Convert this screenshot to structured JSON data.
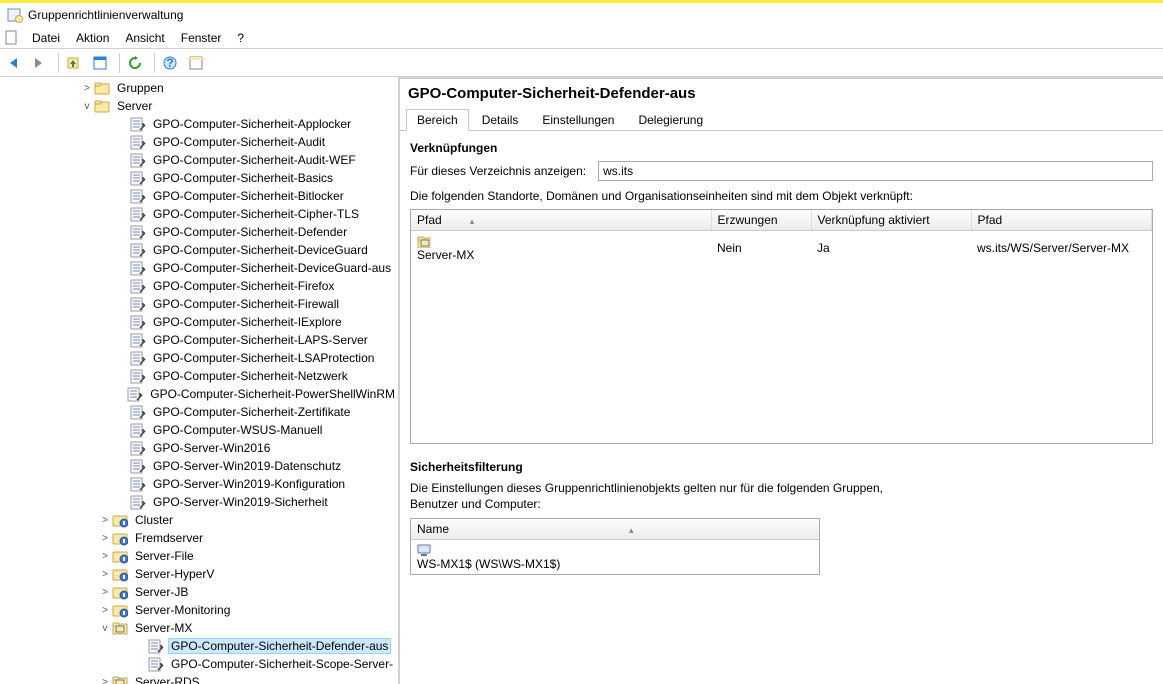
{
  "window_title": "Gruppenrichtlinienverwaltung",
  "menu": {
    "datei": "Datei",
    "aktion": "Aktion",
    "ansicht": "Ansicht",
    "fenster": "Fenster",
    "help": "?"
  },
  "tree": {
    "gruppen": "Gruppen",
    "server": "Server",
    "gpos": [
      "GPO-Computer-Sicherheit-Applocker",
      "GPO-Computer-Sicherheit-Audit",
      "GPO-Computer-Sicherheit-Audit-WEF",
      "GPO-Computer-Sicherheit-Basics",
      "GPO-Computer-Sicherheit-Bitlocker",
      "GPO-Computer-Sicherheit-Cipher-TLS",
      "GPO-Computer-Sicherheit-Defender",
      "GPO-Computer-Sicherheit-DeviceGuard",
      "GPO-Computer-Sicherheit-DeviceGuard-aus",
      "GPO-Computer-Sicherheit-Firefox",
      "GPO-Computer-Sicherheit-Firewall",
      "GPO-Computer-Sicherheit-IExplore",
      "GPO-Computer-Sicherheit-LAPS-Server",
      "GPO-Computer-Sicherheit-LSAProtection",
      "GPO-Computer-Sicherheit-Netzwerk",
      "GPO-Computer-Sicherheit-PowerShellWinRM",
      "GPO-Computer-Sicherheit-Zertifikate",
      "GPO-Computer-WSUS-Manuell",
      "GPO-Server-Win2016",
      "GPO-Server-Win2019-Datenschutz",
      "GPO-Server-Win2019-Konfiguration",
      "GPO-Server-Win2019-Sicherheit"
    ],
    "ous": [
      "Cluster",
      "Fremdserver",
      "Server-File",
      "Server-HyperV",
      "Server-JB",
      "Server-Monitoring"
    ],
    "server_mx": "Server-MX",
    "mx_children": [
      "GPO-Computer-Sicherheit-Defender-aus",
      "GPO-Computer-Sicherheit-Scope-Server-"
    ],
    "server_rds": "Server-RDS"
  },
  "right": {
    "title": "GPO-Computer-Sicherheit-Defender-aus",
    "tabs": {
      "bereich": "Bereich",
      "details": "Details",
      "einstellungen": "Einstellungen",
      "delegierung": "Delegierung"
    },
    "links_header": "Verknüpfungen",
    "links_label": "Für dieses Verzeichnis anzeigen:",
    "domain_value": "ws.its",
    "links_desc": "Die folgenden Standorte, Domänen und Organisationseinheiten sind mit dem Objekt verknüpft:",
    "col_pfad": "Pfad",
    "col_erzwungen": "Erzwungen",
    "col_aktiviert": "Verknüpfung aktiviert",
    "col_pfad2": "Pfad",
    "row": {
      "pfad": "Server-MX",
      "erzwungen": "Nein",
      "aktiviert": "Ja",
      "pfad2": "ws.its/WS/Server/Server-MX"
    },
    "sf_header": "Sicherheitsfilterung",
    "sf_desc": "Die Einstellungen dieses Gruppenrichtlinienobjekts gelten nur für die folgenden Gruppen, Benutzer und Computer:",
    "sf_col": "Name",
    "sf_row": "WS-MX1$ (WS\\WS-MX1$)"
  }
}
